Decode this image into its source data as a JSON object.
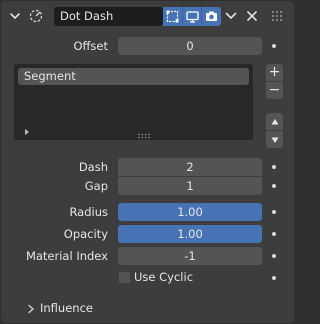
{
  "header": {
    "name": "Dot Dash",
    "icons": [
      "chevron-down-icon",
      "modifier-swirl-icon",
      "edit-mode-icon",
      "viewport-icon",
      "render-camera-icon",
      "dropdown-chevron-icon",
      "close-icon",
      "drag-handle-icon"
    ]
  },
  "offset": {
    "label": "Offset",
    "value": "0"
  },
  "list": {
    "items": [
      "Segment"
    ],
    "add_label": "+",
    "remove_label": "−"
  },
  "dash": {
    "label": "Dash",
    "value": "2"
  },
  "gap": {
    "label": "Gap",
    "value": "1"
  },
  "radius": {
    "label": "Radius",
    "value": "1.00"
  },
  "opacity": {
    "label": "Opacity",
    "value": "1.00"
  },
  "material_index": {
    "label": "Material Index",
    "value": "-1"
  },
  "use_cyclic": {
    "label": "Use Cyclic",
    "checked": false
  },
  "influence": {
    "label": "Influence"
  },
  "colors": {
    "accent": "#4772b3",
    "field": "#545454",
    "panel": "#3d3d3d"
  }
}
